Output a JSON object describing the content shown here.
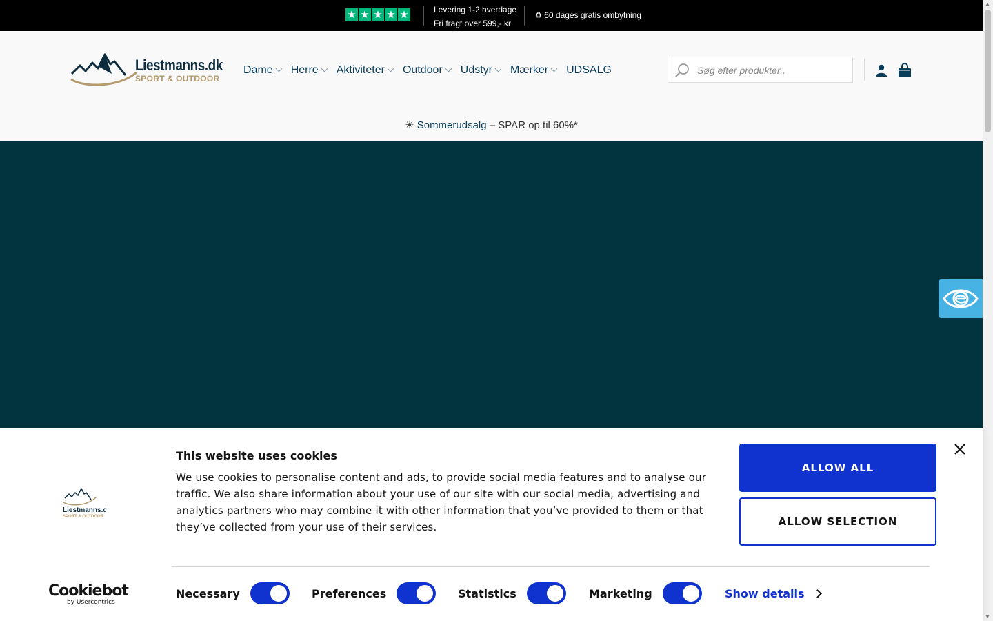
{
  "topbar": {
    "rating_stars": [
      "★",
      "★",
      "★",
      "★",
      "★"
    ],
    "delivery_line1": "Levering 1-2 hverdage",
    "delivery_line2": "Fri fragt over 599,- kr",
    "exchange_icon": "♻",
    "exchange_text": "60 dages gratis ombytning"
  },
  "header": {
    "logo": {
      "name": "Liestmanns.dk",
      "tagline": "SPORT & OUTDOOR"
    },
    "nav": [
      {
        "label": "Dame",
        "has_dropdown": true
      },
      {
        "label": "Herre",
        "has_dropdown": true
      },
      {
        "label": "Aktiviteter",
        "has_dropdown": true
      },
      {
        "label": "Outdoor",
        "has_dropdown": true
      },
      {
        "label": "Udstyr",
        "has_dropdown": true
      },
      {
        "label": "Mærker",
        "has_dropdown": true
      },
      {
        "label": "UDSALG",
        "has_dropdown": false
      }
    ],
    "search": {
      "placeholder": "Søg efter produkter.."
    },
    "icons": [
      "search-icon",
      "user-icon",
      "cart-icon"
    ]
  },
  "promo": {
    "icon": "☀",
    "link": "Sommerudsalg",
    "text": " – SPAR op til 60%*"
  },
  "hero": {
    "background": "#023440"
  },
  "accessibility_widget": {
    "icon": "eye-icon",
    "color": "#47b3e4"
  },
  "cookie_banner": {
    "title": "This website uses cookies",
    "text": "We use cookies to personalise content and ads, to provide social media features and to analyse our traffic. We also share information about your use of our site with our social media, advertising and analytics partners who may combine it with other information that you’ve provided to them or that they’ve collected from your use of their services.",
    "allow_all": "ALLOW ALL",
    "allow_selection": "ALLOW SELECTION",
    "brand_name": "Cookiebot",
    "brand_sub": "by Usercentrics",
    "toggles": [
      {
        "label": "Necessary",
        "on": true
      },
      {
        "label": "Preferences",
        "on": true
      },
      {
        "label": "Statistics",
        "on": true
      },
      {
        "label": "Marketing",
        "on": true
      }
    ],
    "show_details": "Show details",
    "accent_color": "#1032cf"
  }
}
